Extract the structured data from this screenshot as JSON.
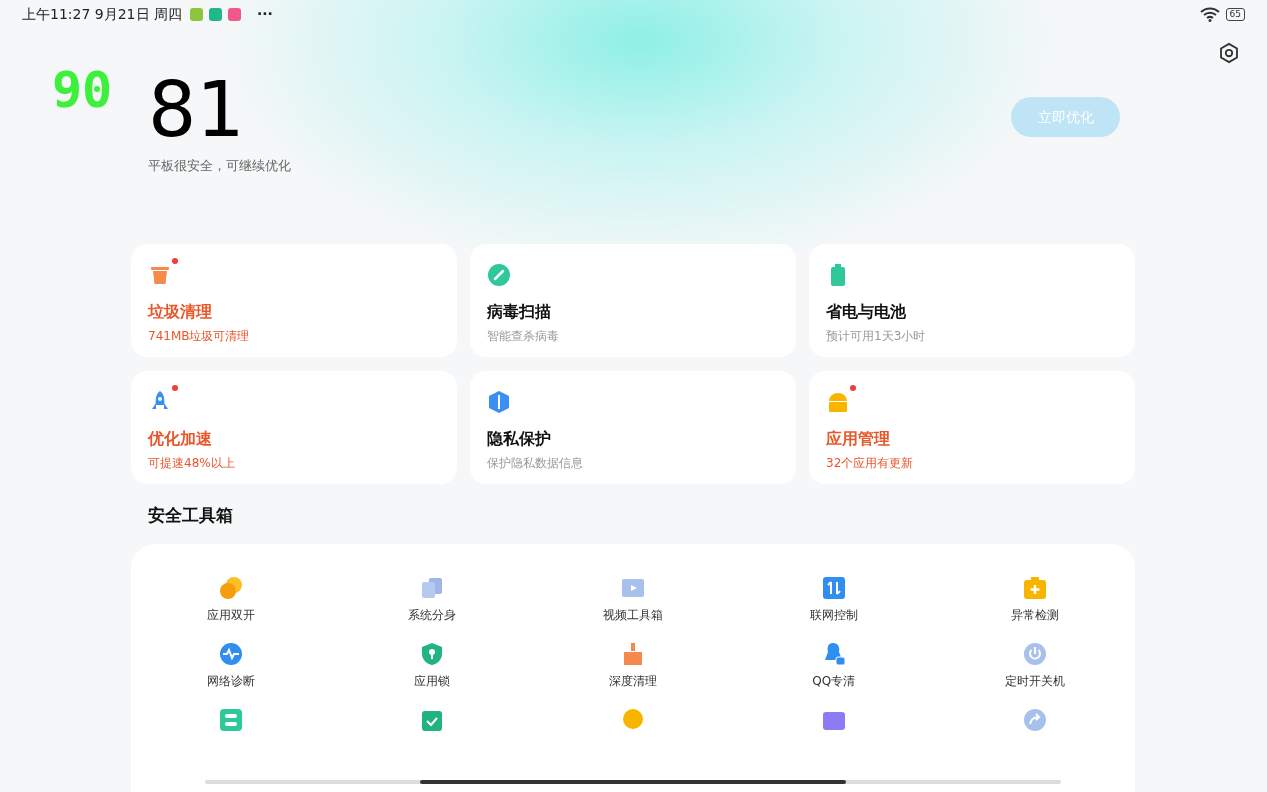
{
  "status_bar": {
    "time": "上午11:27 9月21日 周四",
    "more": "···",
    "battery": "65"
  },
  "fps_counter": "90",
  "score": {
    "value": "81",
    "caption": "平板很安全，可继续优化"
  },
  "optimize_button": {
    "label": "立即优化",
    "disabled": true
  },
  "cards": [
    {
      "title": "垃圾清理",
      "subtitle": "741MB垃圾可清理",
      "alert": true
    },
    {
      "title": "病毒扫描",
      "subtitle": "智能查杀病毒",
      "alert": false
    },
    {
      "title": "省电与电池",
      "subtitle": "预计可用1天3小时",
      "alert": false
    },
    {
      "title": "优化加速",
      "subtitle": "可提速48%以上",
      "alert": true
    },
    {
      "title": "隐私保护",
      "subtitle": "保护隐私数据信息",
      "alert": false
    },
    {
      "title": "应用管理",
      "subtitle": "32个应用有更新",
      "alert": true
    }
  ],
  "toolbox": {
    "title": "安全工具箱",
    "tools": [
      {
        "label": "应用双开"
      },
      {
        "label": "系统分身"
      },
      {
        "label": "视频工具箱"
      },
      {
        "label": "联网控制"
      },
      {
        "label": "异常检测"
      },
      {
        "label": "网络诊断"
      },
      {
        "label": "应用锁"
      },
      {
        "label": "深度清理"
      },
      {
        "label": "QQ专清"
      },
      {
        "label": "定时开关机"
      }
    ]
  }
}
